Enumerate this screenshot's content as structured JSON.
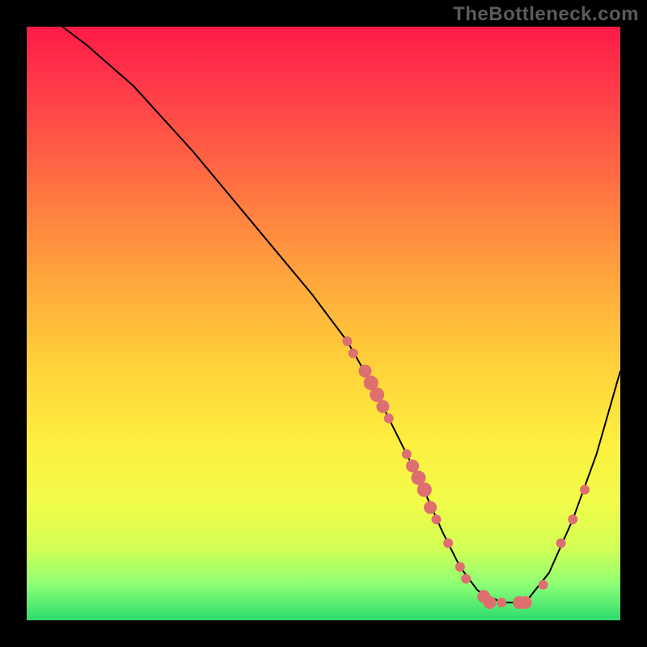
{
  "watermark": "TheBottleneck.com",
  "chart_data": {
    "type": "line",
    "title": "",
    "xlabel": "",
    "ylabel": "",
    "xlim": [
      0,
      100
    ],
    "ylim": [
      0,
      100
    ],
    "series": [
      {
        "name": "curve",
        "x": [
          6,
          10,
          18,
          28,
          38,
          48,
          54,
          58,
          62,
          66,
          70,
          73,
          76,
          80,
          84,
          88,
          92,
          96,
          100
        ],
        "y": [
          100,
          97,
          90,
          79,
          67,
          55,
          47,
          40,
          32,
          24,
          15,
          9,
          5,
          3,
          3,
          8,
          17,
          28,
          42
        ]
      }
    ],
    "scatter": [
      {
        "x": 54,
        "y": 47,
        "r": 6
      },
      {
        "x": 55,
        "y": 45,
        "r": 6
      },
      {
        "x": 57,
        "y": 42,
        "r": 8
      },
      {
        "x": 58,
        "y": 40,
        "r": 9
      },
      {
        "x": 59,
        "y": 38,
        "r": 9
      },
      {
        "x": 60,
        "y": 36,
        "r": 8
      },
      {
        "x": 61,
        "y": 34,
        "r": 6
      },
      {
        "x": 64,
        "y": 28,
        "r": 6
      },
      {
        "x": 65,
        "y": 26,
        "r": 8
      },
      {
        "x": 66,
        "y": 24,
        "r": 9
      },
      {
        "x": 67,
        "y": 22,
        "r": 9
      },
      {
        "x": 68,
        "y": 19,
        "r": 8
      },
      {
        "x": 69,
        "y": 17,
        "r": 6
      },
      {
        "x": 71,
        "y": 13,
        "r": 6
      },
      {
        "x": 73,
        "y": 9,
        "r": 6
      },
      {
        "x": 74,
        "y": 7,
        "r": 6
      },
      {
        "x": 77,
        "y": 4,
        "r": 8
      },
      {
        "x": 78,
        "y": 3,
        "r": 8
      },
      {
        "x": 80,
        "y": 3,
        "r": 6
      },
      {
        "x": 83,
        "y": 3,
        "r": 8
      },
      {
        "x": 84,
        "y": 3,
        "r": 8
      },
      {
        "x": 87,
        "y": 6,
        "r": 6
      },
      {
        "x": 90,
        "y": 13,
        "r": 6
      },
      {
        "x": 92,
        "y": 17,
        "r": 6
      },
      {
        "x": 94,
        "y": 22,
        "r": 6
      }
    ]
  }
}
